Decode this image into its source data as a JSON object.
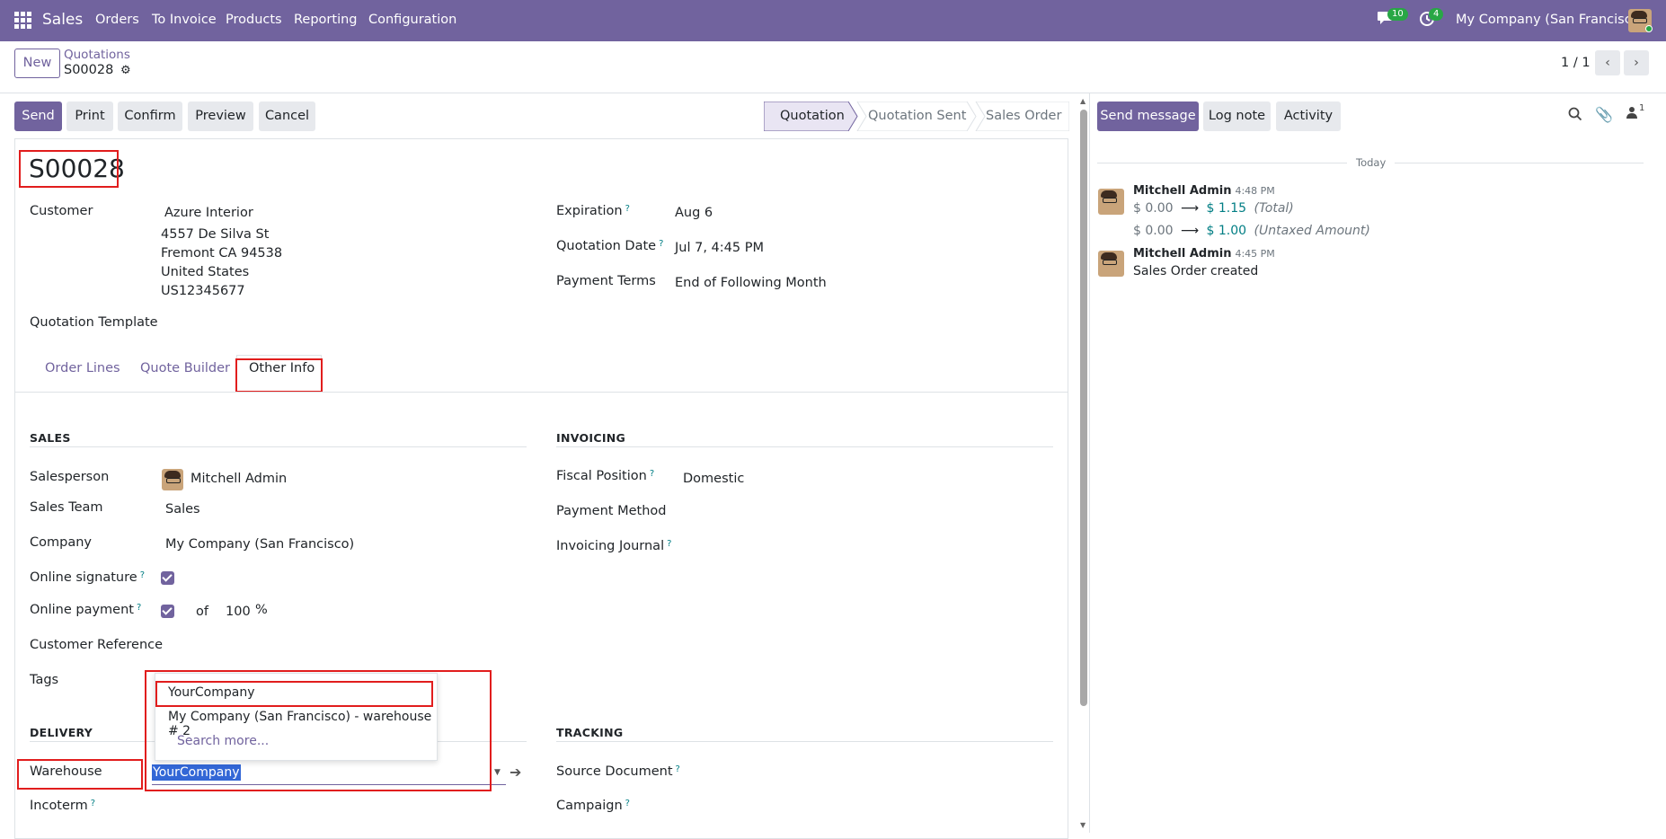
{
  "navbar": {
    "app_name": "Sales",
    "menu": [
      "Orders",
      "To Invoice",
      "Products",
      "Reporting",
      "Configuration"
    ],
    "messages_count": "10",
    "activities_count": "4",
    "company": "My Company (San Francisco)"
  },
  "control_panel": {
    "new_label": "New",
    "breadcrumb_parent": "Quotations",
    "breadcrumb_current": "S00028",
    "pager": "1 / 1"
  },
  "actions": {
    "send": "Send",
    "print": "Print",
    "confirm": "Confirm",
    "preview": "Preview",
    "cancel": "Cancel"
  },
  "statusbar": [
    "Quotation",
    "Quotation Sent",
    "Sales Order"
  ],
  "form": {
    "name": "S00028",
    "customer_label": "Customer",
    "customer_name": "Azure Interior",
    "customer_address": [
      "4557 De Silva St",
      "Fremont CA 94538",
      "United States",
      "US12345677"
    ],
    "quotation_template_label": "Quotation Template",
    "expiration_label": "Expiration",
    "expiration_value": "Aug 6",
    "quotation_date_label": "Quotation Date",
    "quotation_date_value": "Jul 7, 4:45 PM",
    "payment_terms_label": "Payment Terms",
    "payment_terms_value": "End of Following Month"
  },
  "tabs": [
    "Order Lines",
    "Quote Builder",
    "Other Info"
  ],
  "other_info": {
    "sales_title": "SALES",
    "salesperson_label": "Salesperson",
    "salesperson_value": "Mitchell Admin",
    "sales_team_label": "Sales Team",
    "sales_team_value": "Sales",
    "company_label": "Company",
    "company_value": "My Company (San Francisco)",
    "online_signature_label": "Online signature",
    "online_payment_label": "Online payment",
    "of_label": "of",
    "payment_percent": "100",
    "percent_sign": "%",
    "customer_reference_label": "Customer Reference",
    "tags_label": "Tags",
    "invoicing_title": "INVOICING",
    "fiscal_position_label": "Fiscal Position",
    "fiscal_position_value": "Domestic",
    "payment_method_label": "Payment Method",
    "invoicing_journal_label": "Invoicing Journal",
    "delivery_title": "DELIVERY",
    "warehouse_label": "Warehouse",
    "warehouse_value": "YourCompany",
    "incoterm_label": "Incoterm",
    "tracking_title": "TRACKING",
    "source_document_label": "Source Document",
    "campaign_label": "Campaign"
  },
  "warehouse_dropdown": {
    "options": [
      "YourCompany",
      "My Company (San Francisco) - warehouse # 2"
    ],
    "search_more": "Search more..."
  },
  "chatter": {
    "send_message": "Send message",
    "log_note": "Log note",
    "activity": "Activity",
    "followers_count": "1",
    "today": "Today",
    "messages": [
      {
        "author": "Mitchell Admin",
        "time": "4:48 PM",
        "changes": [
          {
            "old": "$ 0.00",
            "new": "$ 1.15",
            "field": "(Total)"
          },
          {
            "old": "$ 0.00",
            "new": "$ 1.00",
            "field": "(Untaxed Amount)"
          }
        ]
      },
      {
        "author": "Mitchell Admin",
        "time": "4:45 PM",
        "body": "Sales Order created"
      }
    ]
  },
  "help_mark": "?",
  "arrow": "⟶",
  "colors": {
    "brand": "#71639e",
    "link": "#017e84",
    "highlight": "#e11d1d"
  }
}
